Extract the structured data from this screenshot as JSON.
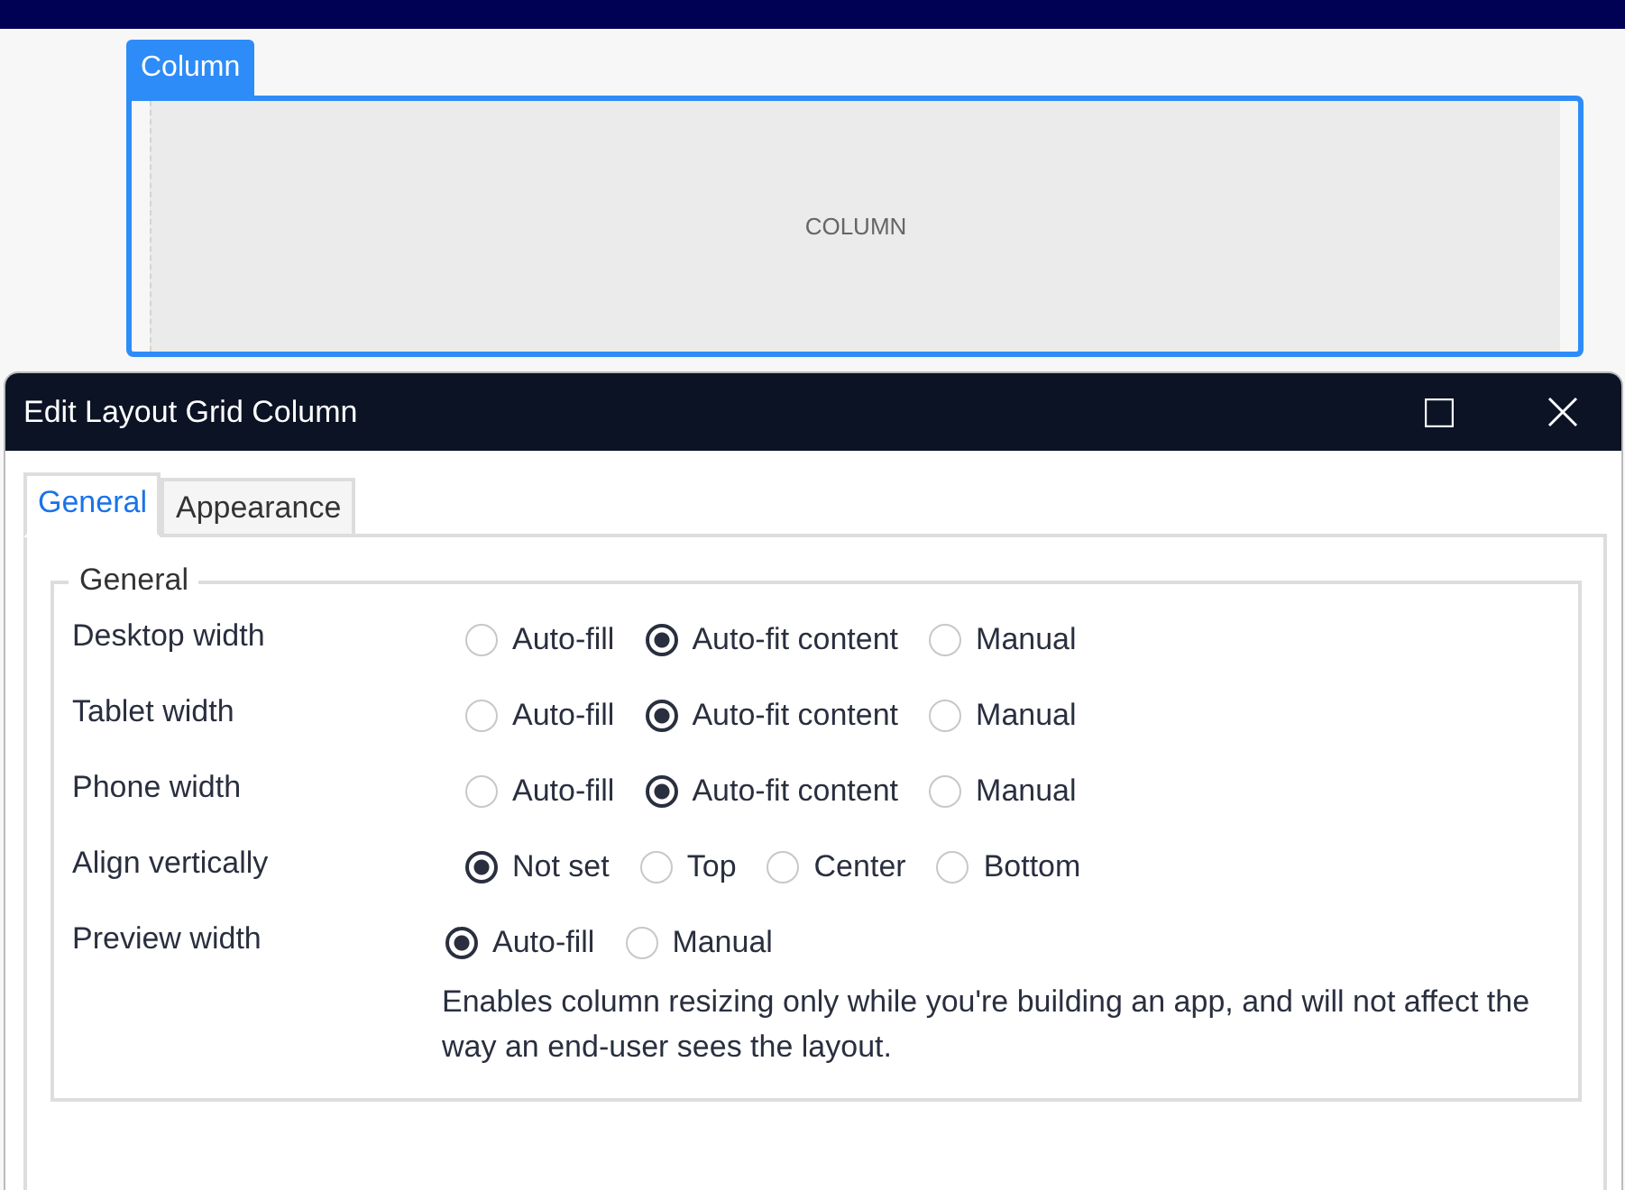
{
  "canvas": {
    "column_tab": "Column",
    "column_placeholder": "COLUMN"
  },
  "dialog": {
    "title": "Edit Layout Grid Column",
    "tabs": [
      {
        "label": "General",
        "selected": true
      },
      {
        "label": "Appearance",
        "selected": false
      }
    ],
    "group": {
      "title": "General",
      "rows": [
        {
          "label": "Desktop width",
          "options": [
            {
              "label": "Auto-fill",
              "selected": false
            },
            {
              "label": "Auto-fit content",
              "selected": true
            },
            {
              "label": "Manual",
              "selected": false
            }
          ]
        },
        {
          "label": "Tablet width",
          "options": [
            {
              "label": "Auto-fill",
              "selected": false
            },
            {
              "label": "Auto-fit content",
              "selected": true
            },
            {
              "label": "Manual",
              "selected": false
            }
          ]
        },
        {
          "label": "Phone width",
          "options": [
            {
              "label": "Auto-fill",
              "selected": false
            },
            {
              "label": "Auto-fit content",
              "selected": true
            },
            {
              "label": "Manual",
              "selected": false
            }
          ]
        },
        {
          "label": "Align vertically",
          "options": [
            {
              "label": "Not set",
              "selected": true
            },
            {
              "label": "Top",
              "selected": false
            },
            {
              "label": "Center",
              "selected": false
            },
            {
              "label": "Bottom",
              "selected": false
            }
          ]
        },
        {
          "label": "Preview width",
          "options": [
            {
              "label": "Auto-fill",
              "selected": true
            },
            {
              "label": "Manual",
              "selected": false
            }
          ],
          "description": "Enables column resizing only while you're building an app, and will not affect the way an end-user sees the layout."
        }
      ]
    }
  }
}
